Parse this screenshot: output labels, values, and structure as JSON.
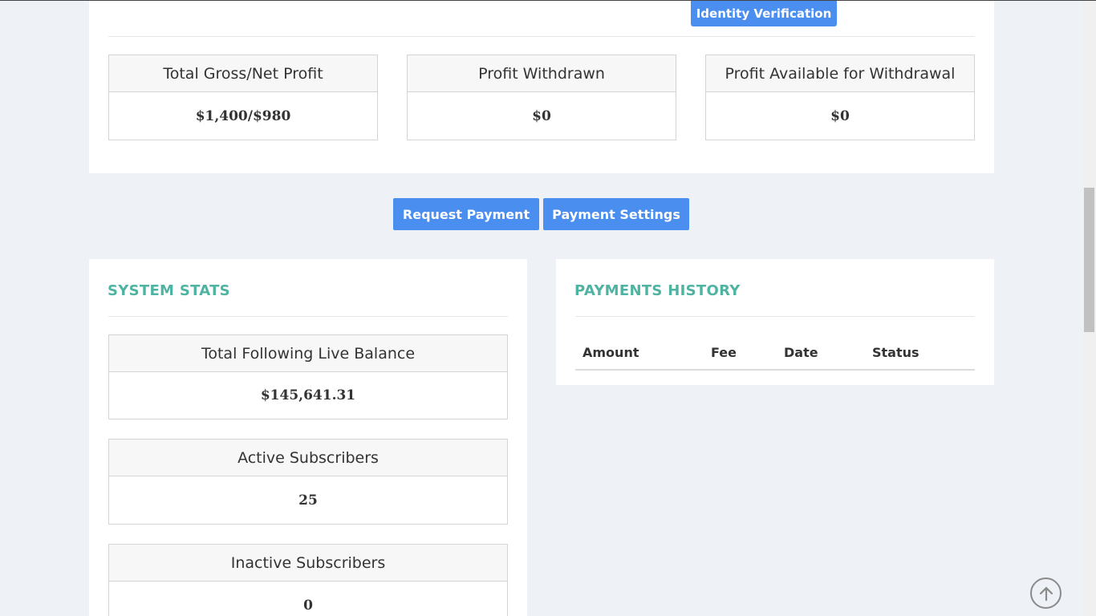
{
  "top": {
    "identity_button": "Identity Verification",
    "stats": [
      {
        "label": "Total Gross/Net Profit",
        "value": "$1,400/$980"
      },
      {
        "label": "Profit Withdrawn",
        "value": "$0"
      },
      {
        "label": "Profit Available for Withdrawal",
        "value": "$0"
      }
    ]
  },
  "actions": {
    "request_payment": "Request Payment",
    "payment_settings": "Payment Settings"
  },
  "system_stats": {
    "title": "SYSTEM STATS",
    "items": [
      {
        "label": "Total Following Live Balance",
        "value": "$145,641.31"
      },
      {
        "label": "Active Subscribers",
        "value": "25"
      },
      {
        "label": "Inactive Subscribers",
        "value": "0"
      }
    ]
  },
  "payments_history": {
    "title": "PAYMENTS HISTORY",
    "columns": [
      "Amount",
      "Fee",
      "Date",
      "Status"
    ]
  },
  "icons": {
    "back_to_top": "arrow-up-circle-icon"
  },
  "colors": {
    "accent_button": "#4a8ef0",
    "section_title": "#4fb3a2",
    "page_background": "#eef1f5"
  }
}
